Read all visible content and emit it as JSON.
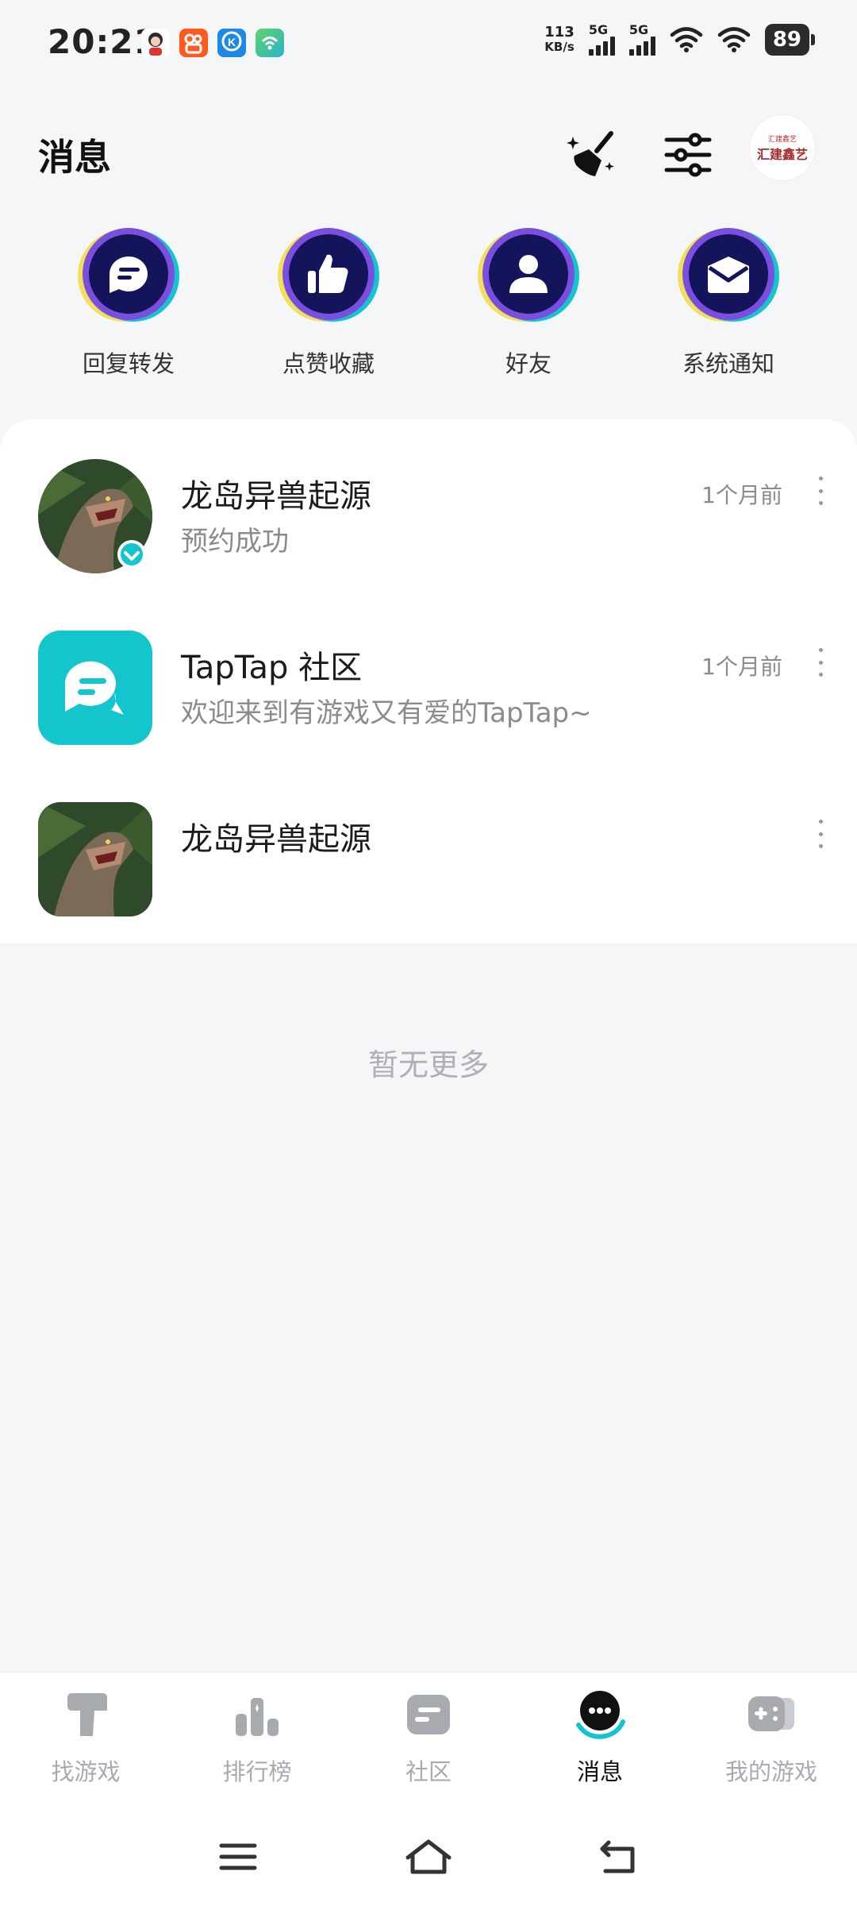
{
  "status_bar": {
    "time": "20:21",
    "net_speed_value": "113",
    "net_speed_unit": "KB/s",
    "sim1": "5G",
    "sim2": "5G",
    "battery": "89"
  },
  "header": {
    "title": "消息",
    "avatar_line1": "汇建鑫艺",
    "avatar_line2": "汇建鑫艺"
  },
  "shortcuts": [
    {
      "label": "回复转发",
      "icon": "reply-bubble-icon"
    },
    {
      "label": "点赞收藏",
      "icon": "thumbs-up-icon"
    },
    {
      "label": "好友",
      "icon": "person-icon"
    },
    {
      "label": "系统通知",
      "icon": "envelope-icon"
    }
  ],
  "messages": [
    {
      "title": "龙岛异兽起源",
      "subtitle": "预约成功",
      "time": "1个月前"
    },
    {
      "title": "TapTap 社区",
      "subtitle": "欢迎来到有游戏又有爱的TapTap~",
      "time": "1个月前"
    },
    {
      "title": "龙岛异兽起源",
      "subtitle": "",
      "time": ""
    }
  ],
  "empty_text": "暂无更多",
  "tabs": [
    {
      "label": "找游戏"
    },
    {
      "label": "排行榜"
    },
    {
      "label": "社区"
    },
    {
      "label": "消息"
    },
    {
      "label": "我的游戏"
    }
  ],
  "colors": {
    "accent_teal": "#15c5ce",
    "icon_navy": "#14145a",
    "icon_purple": "#7a4fe0",
    "icon_yellow": "#f2e05a"
  }
}
